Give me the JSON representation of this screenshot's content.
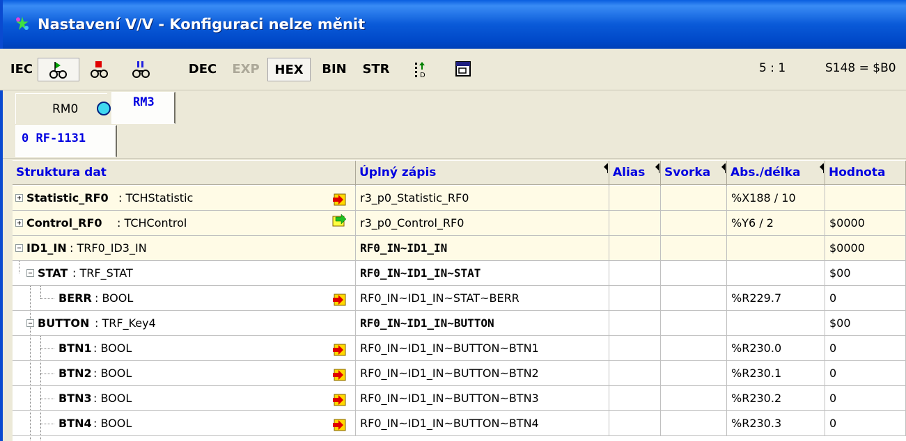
{
  "window": {
    "title": "Nastavení V/V - Konfiguraci nelze měnit"
  },
  "toolbar": {
    "iec": "IEC",
    "dec": "DEC",
    "exp": "EXP",
    "hex": "HEX",
    "bin": "BIN",
    "str": "STR",
    "position": "5 : 1",
    "status": "S148 = $B0"
  },
  "tabs_modules": [
    "RM0",
    "RM3"
  ],
  "tabs_sub": [
    "0 RF-1131"
  ],
  "grid": {
    "columns": [
      "Struktura dat",
      "Úplný zápis",
      "Alias",
      "Svorka",
      "Abs./délka",
      "Hodnota"
    ],
    "rows": [
      {
        "name": "Statistic_RF0",
        "type": " : TCHStatistic",
        "full": "r3_p0_Statistic_RF0",
        "alias": "",
        "svorka": "",
        "abs": "%X188 / 10",
        "value": ""
      },
      {
        "name": "Control_RF0",
        "type": " : TCHControl",
        "full": "r3_p0_Control_RF0",
        "alias": "",
        "svorka": "",
        "abs": "%Y6 / 2",
        "value": "$0000"
      },
      {
        "name": "ID1_IN",
        "type": " : TRF0_ID3_IN",
        "full": "RF0_IN~ID1_IN",
        "alias": "",
        "svorka": "",
        "abs": "",
        "value": "$0000"
      },
      {
        "name": "STAT",
        "type": " : TRF_STAT",
        "full": "RF0_IN~ID1_IN~STAT",
        "alias": "",
        "svorka": "",
        "abs": "",
        "value": "$00"
      },
      {
        "name": "BERR",
        "type": " : BOOL",
        "full": "RF0_IN~ID1_IN~STAT~BERR",
        "alias": "",
        "svorka": "",
        "abs": "%R229.7",
        "value": "0"
      },
      {
        "name": "BUTTON",
        "type": " : TRF_Key4",
        "full": "RF0_IN~ID1_IN~BUTTON",
        "alias": "",
        "svorka": "",
        "abs": "",
        "value": "$00"
      },
      {
        "name": "BTN1",
        "type": " : BOOL",
        "full": "RF0_IN~ID1_IN~BUTTON~BTN1",
        "alias": "",
        "svorka": "",
        "abs": "%R230.0",
        "value": "0"
      },
      {
        "name": "BTN2",
        "type": " : BOOL",
        "full": "RF0_IN~ID1_IN~BUTTON~BTN2",
        "alias": "",
        "svorka": "",
        "abs": "%R230.1",
        "value": "0"
      },
      {
        "name": "BTN3",
        "type": " : BOOL",
        "full": "RF0_IN~ID1_IN~BUTTON~BTN3",
        "alias": "",
        "svorka": "",
        "abs": "%R230.2",
        "value": "0"
      },
      {
        "name": "BTN4",
        "type": " : BOOL",
        "full": "RF0_IN~ID1_IN~BUTTON~BTN4",
        "alias": "",
        "svorka": "",
        "abs": "%R230.3",
        "value": "0"
      }
    ]
  },
  "colors": {
    "title_bar": "#0a5ad8",
    "header_text": "#0000e0",
    "yellow_row": "#fffbe6",
    "tab_active_text": "#0000e0"
  },
  "icons": [
    "app-icon",
    "run-icon",
    "stop-icon",
    "pause-icon",
    "sort-icon",
    "window-icon",
    "radio-indicator-icon",
    "arrow-red-icon",
    "arrow-green-icon"
  ]
}
